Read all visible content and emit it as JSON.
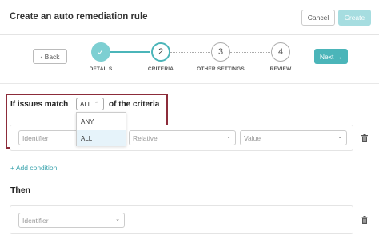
{
  "header": {
    "title": "Create an auto remediation rule",
    "cancel_label": "Cancel",
    "create_label": "Create"
  },
  "wizard": {
    "back_label": "‹ Back",
    "next_label": "Next →",
    "steps": [
      {
        "label": "DETAILS",
        "number": "✓",
        "state": "done"
      },
      {
        "label": "CRITERIA",
        "number": "2",
        "state": "active"
      },
      {
        "label": "OTHER SETTINGS",
        "number": "3",
        "state": "todo"
      },
      {
        "label": "REVIEW",
        "number": "4",
        "state": "todo"
      }
    ]
  },
  "criteria": {
    "prefix": "If issues match",
    "suffix": "of the criteria",
    "match_value": "ALL",
    "match_options": [
      "ANY",
      "ALL"
    ],
    "selected_option": "ALL"
  },
  "condition": {
    "identifier_placeholder": "Identifier",
    "relation_placeholder": "Relative",
    "value_placeholder": "Value"
  },
  "add_condition_label": "+ Add condition",
  "then": {
    "heading": "Then",
    "identifier_placeholder": "Identifier"
  },
  "colors": {
    "accent": "#4bb5b9",
    "highlight": "#8c2c3a"
  }
}
